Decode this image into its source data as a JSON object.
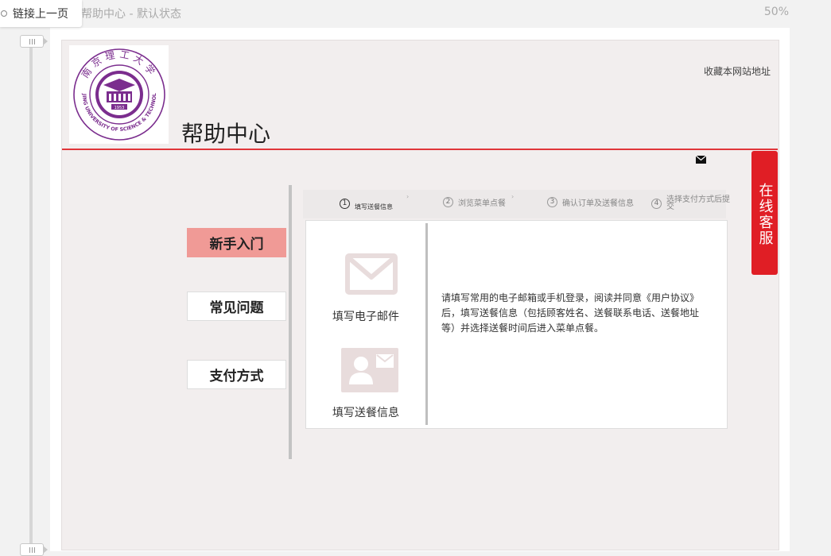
{
  "topbar": {
    "back_tab": "链接上一页",
    "page_title": "帮助中心 - 默认状态",
    "zoom": "50%"
  },
  "header": {
    "site_title": "帮助中心",
    "bookmark": "收藏本网站地址",
    "logo": {
      "name_cn": "南京理工大学",
      "name_en": "NANJING UNIVERSITY OF SCIENCE & TECHNOLOGY",
      "year": "1953"
    }
  },
  "service": {
    "label": "在线客服"
  },
  "menu": {
    "items": [
      {
        "label": "新手入门",
        "active": true
      },
      {
        "label": "常见问题",
        "active": false
      },
      {
        "label": "支付方式",
        "active": false
      }
    ]
  },
  "steps": [
    {
      "num": "1",
      "label": "填写送餐信息"
    },
    {
      "num": "2",
      "label": "浏览菜单点餐"
    },
    {
      "num": "3",
      "label": "确认订单及送餐信息"
    },
    {
      "num": "4",
      "label": "选择支付方式后提交"
    }
  ],
  "content": {
    "email_label": "填写电子邮件",
    "delivery_label": "填写送餐信息",
    "description": "请填写常用的电子邮箱或手机登录，阅读并同意《用户协议》后，填写送餐信息（包括顾客姓名、送餐联系电话、送餐地址等）并选择送餐时间后进入菜单点餐。"
  },
  "colors": {
    "accent": "#e0353a",
    "service_bg": "#e01e25",
    "active_menu": "#f09a96",
    "logo_purple": "#7b2d8e"
  }
}
